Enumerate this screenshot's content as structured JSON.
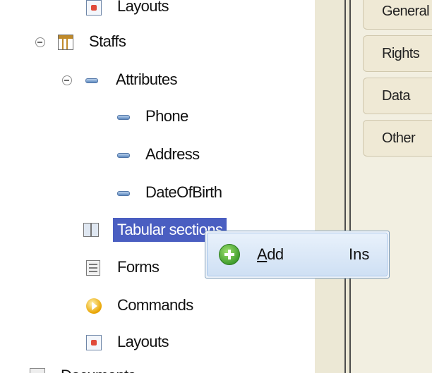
{
  "tree": {
    "layouts_top_label": "Layouts",
    "staffs_label": "Staffs",
    "attributes_label": "Attributes",
    "attributes": [
      {
        "label": "Phone"
      },
      {
        "label": "Address"
      },
      {
        "label": "DateOfBirth"
      }
    ],
    "tabular_label": "Tabular sections",
    "forms_label": "Forms",
    "commands_label": "Commands",
    "layouts_label": "Layouts",
    "documents_label": "Documents"
  },
  "context_menu": {
    "add_mnemonic": "A",
    "add_rest": "dd",
    "add_shortcut": "Ins"
  },
  "right_panel": {
    "tabs": [
      {
        "label": "General"
      },
      {
        "label": "Rights"
      },
      {
        "label": "Data"
      },
      {
        "label": "Other"
      }
    ]
  },
  "icons": {
    "staffs": "catalog-icon",
    "attribute": "attribute-icon",
    "tabular": "tabular-section-icon",
    "forms": "form-icon",
    "commands": "command-icon",
    "layouts": "layout-icon",
    "add": "add-icon"
  },
  "colors": {
    "selection": "#4a5ec1",
    "menu_highlight": "#cfe0f4",
    "panel_bg": "#f2efe1"
  }
}
